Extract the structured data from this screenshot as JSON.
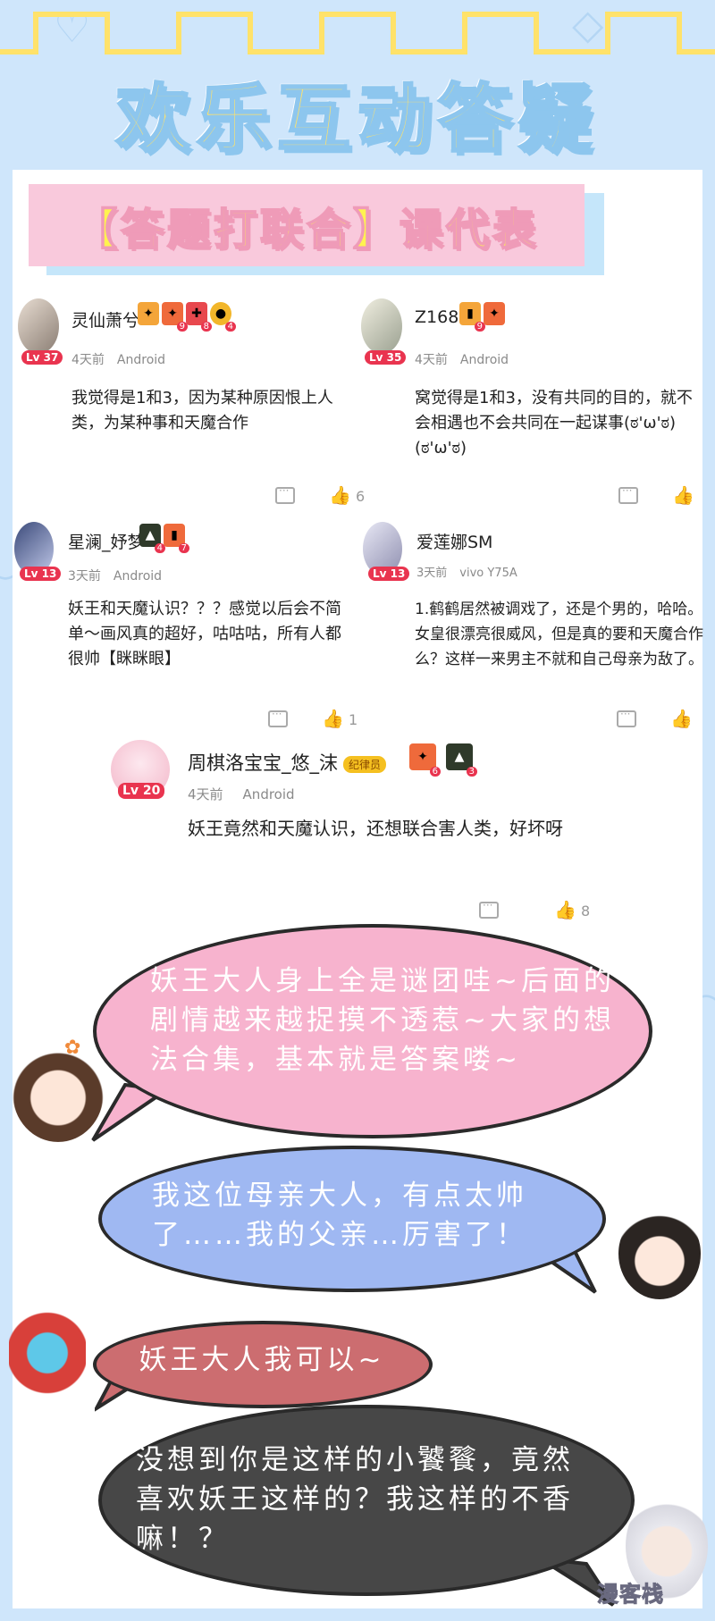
{
  "header": {
    "title": "欢乐互动答疑"
  },
  "banner": {
    "label": "【答题打联合】课代表"
  },
  "comments": [
    {
      "user": "灵仙萧兮",
      "level": "Lv 37",
      "time": "4天前",
      "device": "Android",
      "badges": [
        "",
        "9",
        "8",
        "4"
      ],
      "text": "我觉得是1和3，因为某种原因恨上人类，为某种事和天魔合作",
      "likes": "6"
    },
    {
      "user": "Z168",
      "level": "Lv 35",
      "time": "4天前",
      "device": "Android",
      "badges": [
        "9",
        ""
      ],
      "text": "窝觉得是1和3，没有共同的目的，就不会相遇也不会共同在一起谋事(ಠ'ω'ಠ)(ಠ'ω'ಠ)",
      "likes": ""
    },
    {
      "user": "星澜_妤梦",
      "level": "Lv 13",
      "time": "3天前",
      "device": "Android",
      "badges": [
        "4",
        "7"
      ],
      "text": "妖王和天魔认识？？？感觉以后会不简单～画风真的超好，咕咕咕，所有人都很帅【眯眯眼】",
      "likes": "1"
    },
    {
      "user": "爱莲娜SM",
      "level": "Lv 13",
      "time": "3天前",
      "device": "vivo Y75A",
      "badges": [],
      "text": "1.鹤鹤居然被调戏了，还是个男的，哈哈。女皇很漂亮很威风，但是真的要和天魔合作么？这样一来男主不就和自己母亲为敌了。",
      "likes": ""
    },
    {
      "user": "周棋洛宝宝_悠_沫",
      "level": "Lv 20",
      "time": "4天前",
      "device": "Android",
      "official": "纪律员",
      "badges": [
        "6",
        "3"
      ],
      "text": "妖王竟然和天魔认识，还想联合害人类，好坏呀",
      "likes": "8"
    }
  ],
  "dialogue": [
    {
      "text": "妖王大人身上全是谜团哇~后面的剧情越来越捉摸不透惹~大家的想法合集，基本就是答案喽~"
    },
    {
      "text": "我这位母亲大人，有点太帅了……我的父亲…厉害了！"
    },
    {
      "text": "妖王大人我可以~"
    },
    {
      "text": "没想到你是这样的小饕餮，竟然喜欢妖王这样的？我这样的不香嘛！？"
    }
  ],
  "colors": {
    "pink": "#f7b3ce",
    "blue": "#9fb8f2",
    "rose": "#cc6d70",
    "dark": "#474747",
    "yellow": "#ffe26a"
  },
  "watermark": "漫客栈"
}
